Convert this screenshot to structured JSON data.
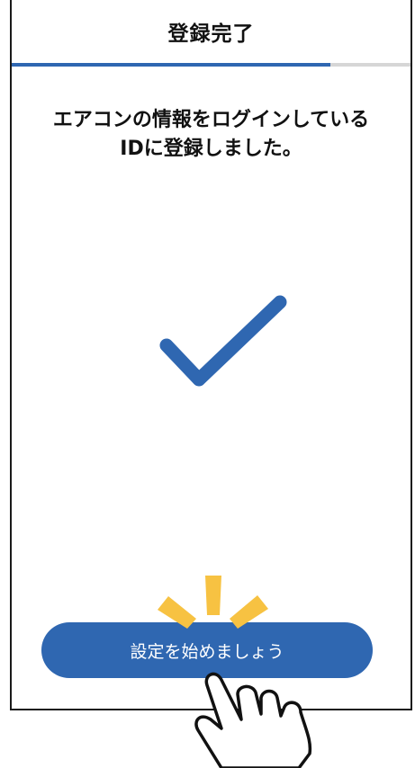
{
  "header": {
    "title": "登録完了"
  },
  "progress": {
    "fraction": 0.8
  },
  "message": {
    "line1": "エアコンの情報をログインしている",
    "line2": "IDに登録しました。"
  },
  "icons": {
    "success": "checkmark-icon",
    "tap_hint": "hand-pointer-icon",
    "tap_highlight": "tap-rays-icon"
  },
  "button": {
    "label": "設定を始めましょう"
  },
  "colors": {
    "accent": "#2f67b1",
    "ray": "#f7c242",
    "text": "#111111"
  }
}
